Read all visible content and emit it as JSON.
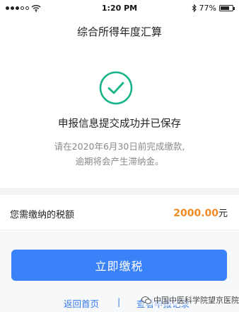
{
  "status_bar": {
    "time": "1:20 PM",
    "battery": "77%",
    "battery_level": 0.77
  },
  "header": {
    "title": "综合所得年度汇算"
  },
  "result": {
    "icon": "check-circle-icon",
    "title": "申报信息提交成功并已保存",
    "hint_line1": "请在2020年6月30日前完成缴款,",
    "hint_line2": "逾期将会产生滞纳金。"
  },
  "tax": {
    "label": "您需缴纳的税额",
    "amount": "2000.00",
    "unit": "元"
  },
  "actions": {
    "pay_label": "立即缴税",
    "home_link": "返回首页",
    "separator": "|",
    "other_link": "查看申报记录"
  },
  "watermark": {
    "text": "中国中医科学院望京医院"
  },
  "colors": {
    "accent": "#3a82f7",
    "success": "#19b48a",
    "amount": "#f08a24",
    "link": "#3a7be8"
  }
}
